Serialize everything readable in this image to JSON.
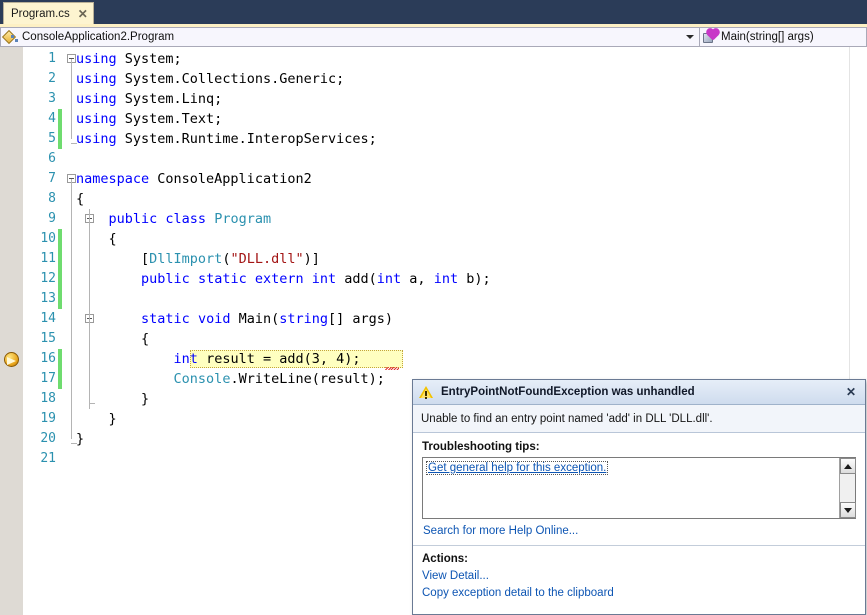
{
  "tab": {
    "label": "Program.cs",
    "close_glyph": "✕"
  },
  "navbar": {
    "type_value": "ConsoleApplication2.Program",
    "member_value": "Main(string[] args)"
  },
  "editor": {
    "lines": [
      {
        "n": "1",
        "changed": false,
        "outline": "start",
        "outline2": "none",
        "segments": [
          {
            "t": "using ",
            "c": "k"
          },
          {
            "t": "System;",
            "c": "p"
          }
        ]
      },
      {
        "n": "2",
        "changed": false,
        "outline": "vline",
        "outline2": "none",
        "segments": [
          {
            "t": "using ",
            "c": "k"
          },
          {
            "t": "System.Collections.Generic;",
            "c": "p"
          }
        ]
      },
      {
        "n": "3",
        "changed": false,
        "outline": "vline",
        "outline2": "none",
        "segments": [
          {
            "t": "using ",
            "c": "k"
          },
          {
            "t": "System.Linq;",
            "c": "p"
          }
        ]
      },
      {
        "n": "4",
        "changed": true,
        "outline": "vline",
        "outline2": "none",
        "segments": [
          {
            "t": "using ",
            "c": "k"
          },
          {
            "t": "System.Text;",
            "c": "p"
          }
        ]
      },
      {
        "n": "5",
        "changed": true,
        "outline": "end",
        "outline2": "none",
        "segments": [
          {
            "t": "using ",
            "c": "k"
          },
          {
            "t": "System.Runtime.InteropServices;",
            "c": "p"
          }
        ]
      },
      {
        "n": "6",
        "changed": false,
        "outline": "none",
        "outline2": "none",
        "segments": []
      },
      {
        "n": "7",
        "changed": false,
        "outline": "start",
        "outline2": "none",
        "segments": [
          {
            "t": "namespace ",
            "c": "k"
          },
          {
            "t": "ConsoleApplication2",
            "c": "p"
          }
        ]
      },
      {
        "n": "8",
        "changed": false,
        "outline": "vline",
        "outline2": "none",
        "segments": [
          {
            "t": "{",
            "c": "p"
          }
        ]
      },
      {
        "n": "9",
        "changed": false,
        "outline": "vline",
        "outline2": "start",
        "segments": [
          {
            "t": "    ",
            "c": "p"
          },
          {
            "t": "public ",
            "c": "k"
          },
          {
            "t": "class ",
            "c": "k"
          },
          {
            "t": "Program",
            "c": "t"
          }
        ]
      },
      {
        "n": "10",
        "changed": true,
        "outline": "vline",
        "outline2": "vline",
        "segments": [
          {
            "t": "    {",
            "c": "p"
          }
        ]
      },
      {
        "n": "11",
        "changed": true,
        "outline": "vline",
        "outline2": "vline",
        "segments": [
          {
            "t": "        [",
            "c": "p"
          },
          {
            "t": "DllImport",
            "c": "t"
          },
          {
            "t": "(",
            "c": "p"
          },
          {
            "t": "\"DLL.dll\"",
            "c": "s"
          },
          {
            "t": ")]",
            "c": "p"
          }
        ]
      },
      {
        "n": "12",
        "changed": true,
        "outline": "vline",
        "outline2": "vline",
        "segments": [
          {
            "t": "        ",
            "c": "p"
          },
          {
            "t": "public ",
            "c": "k"
          },
          {
            "t": "static ",
            "c": "k"
          },
          {
            "t": "extern ",
            "c": "k"
          },
          {
            "t": "int ",
            "c": "k"
          },
          {
            "t": "add(",
            "c": "p"
          },
          {
            "t": "int ",
            "c": "k"
          },
          {
            "t": "a, ",
            "c": "p"
          },
          {
            "t": "int ",
            "c": "k"
          },
          {
            "t": "b);",
            "c": "p"
          }
        ]
      },
      {
        "n": "13",
        "changed": true,
        "outline": "vline",
        "outline2": "vline",
        "segments": []
      },
      {
        "n": "14",
        "changed": false,
        "outline": "vline",
        "outline2": "start",
        "segments": [
          {
            "t": "        ",
            "c": "p"
          },
          {
            "t": "static ",
            "c": "k"
          },
          {
            "t": "void ",
            "c": "k"
          },
          {
            "t": "Main(",
            "c": "p"
          },
          {
            "t": "string",
            "c": "k"
          },
          {
            "t": "[] args)",
            "c": "p"
          }
        ]
      },
      {
        "n": "15",
        "changed": false,
        "outline": "vline",
        "outline2": "vline",
        "segments": [
          {
            "t": "        {",
            "c": "p"
          }
        ]
      },
      {
        "n": "16",
        "changed": true,
        "outline": "vline",
        "outline2": "vline",
        "current": true,
        "segments": [
          {
            "t": "            ",
            "c": "p"
          },
          {
            "t": "int ",
            "c": "k"
          },
          {
            "t": "result = add(3, 4);",
            "c": "p"
          }
        ]
      },
      {
        "n": "17",
        "changed": true,
        "outline": "vline",
        "outline2": "vline",
        "segments": [
          {
            "t": "            ",
            "c": "p"
          },
          {
            "t": "Console",
            "c": "t"
          },
          {
            "t": ".WriteLine(result);",
            "c": "p"
          }
        ]
      },
      {
        "n": "18",
        "changed": false,
        "outline": "vline",
        "outline2": "end",
        "segments": [
          {
            "t": "        }",
            "c": "p"
          }
        ]
      },
      {
        "n": "19",
        "changed": false,
        "outline": "vline",
        "outline2": "none",
        "segments": [
          {
            "t": "    }",
            "c": "p"
          }
        ]
      },
      {
        "n": "20",
        "changed": false,
        "outline": "end",
        "outline2": "none",
        "segments": [
          {
            "t": "}",
            "c": "p"
          }
        ]
      },
      {
        "n": "21",
        "changed": false,
        "outline": "none",
        "outline2": "none",
        "segments": []
      }
    ]
  },
  "exception_dialog": {
    "title": "EntryPointNotFoundException was unhandled",
    "close_glyph": "✕",
    "message": "Unable to find an entry point named 'add' in DLL 'DLL.dll'.",
    "tips_heading": "Troubleshooting tips:",
    "tips": [
      "Get general help for this exception."
    ],
    "search_link": "Search for more Help Online...",
    "actions_heading": "Actions:",
    "actions": [
      "View Detail...",
      "Copy exception detail to the clipboard"
    ]
  },
  "colors": {
    "tab_background": "#fdf4d0",
    "tabstrip_background": "#2b3c58",
    "keyword": "#0000ff",
    "type": "#2b91af",
    "string": "#a31515",
    "line_number": "#2b91af",
    "current_statement": "#ffffc0",
    "change_bar": "#6fdc6f",
    "link": "#0d55b3"
  }
}
